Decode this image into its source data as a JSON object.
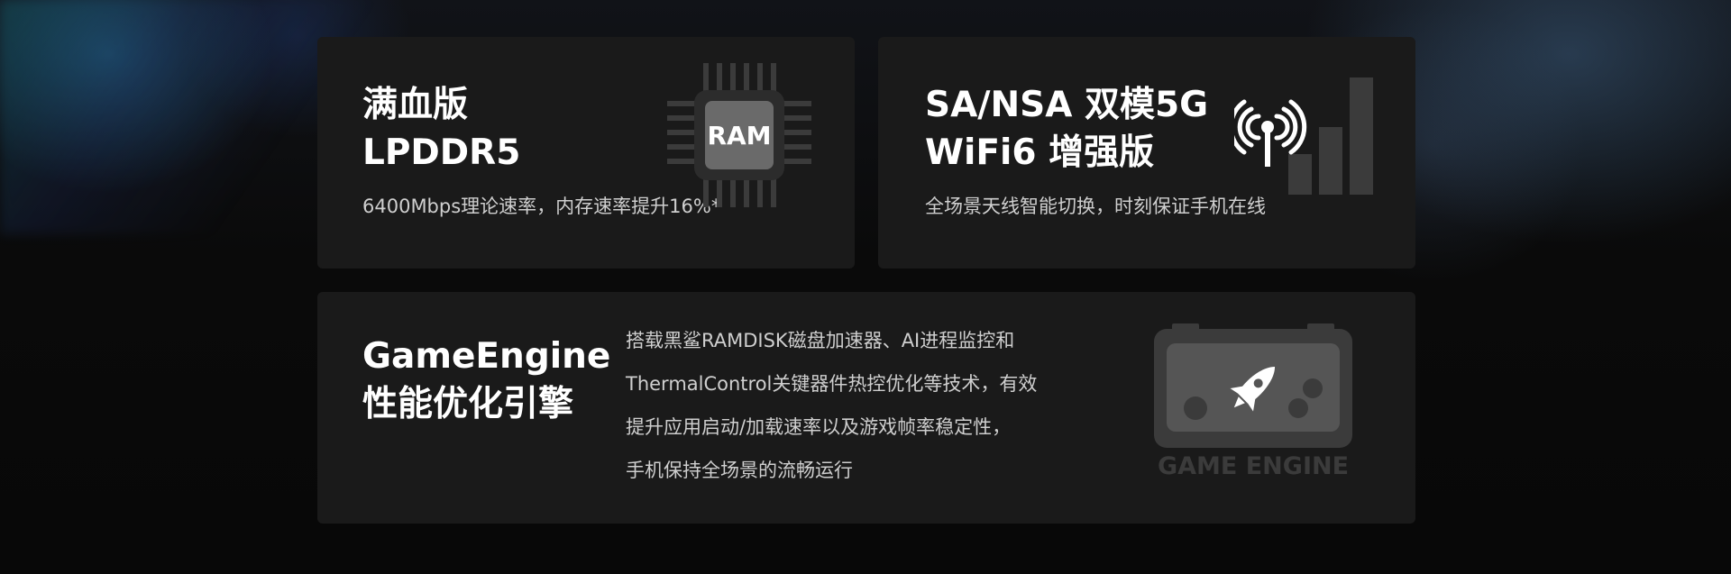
{
  "cards": {
    "ram": {
      "title_line1": "满血版",
      "title_line2": "LPDDR5",
      "subtitle": "6400Mbps理论速率，内存速率提升16%*",
      "icon_label": "RAM",
      "icon": "ram-chip-icon"
    },
    "fiveg": {
      "title_line1": "SA/NSA 双模5G",
      "title_line2": "WiFi6 增强版",
      "subtitle": "全场景天线智能切换，时刻保证手机在线",
      "icon": "signal-antenna-icon"
    },
    "gameengine": {
      "title_line1": "GameEngine",
      "title_line2": "性能优化引擎",
      "desc_lines": [
        "搭载黑鲨RAMDISK磁盘加速器、AI进程监控和",
        "ThermalControl关键器件热控优化等技术，有效",
        "提升应用启动/加载速率以及游戏帧率稳定性，",
        "手机保持全场景的流畅运行"
      ],
      "icon_label": "GAME ENGINE",
      "icon": "gamepad-rocket-icon"
    }
  },
  "colors": {
    "background": "#0a0a0a",
    "card": "#1a1a1a",
    "title": "#ffffff",
    "text": "#cfcfcf",
    "icon": "#3b3b3b"
  }
}
